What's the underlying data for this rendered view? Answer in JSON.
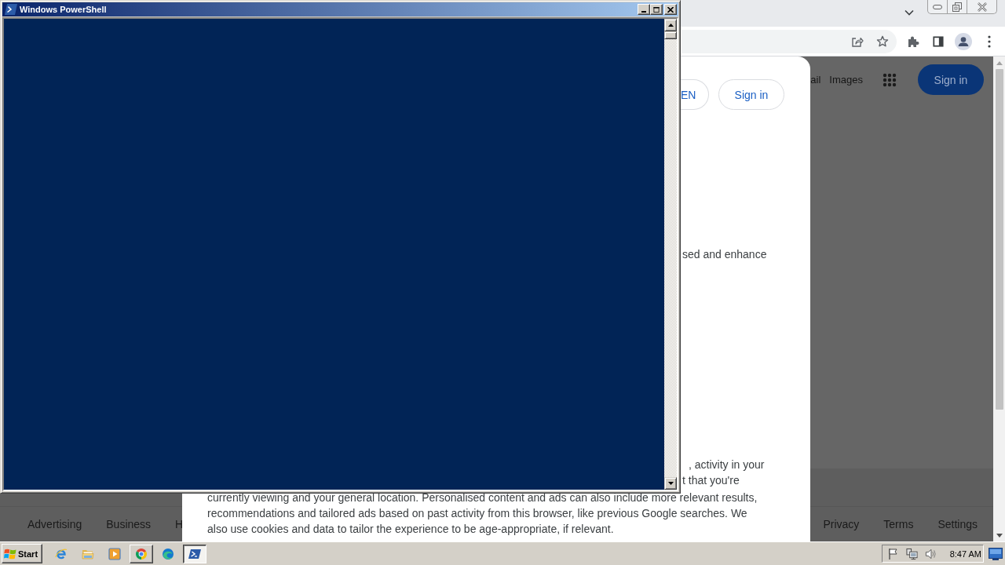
{
  "powershell_window": {
    "title": "Windows PowerShell"
  },
  "browser": {
    "page_header": {
      "links": [
        "ail",
        "Images"
      ],
      "sign_in_button": "Sign in"
    },
    "footer": {
      "left_links": [
        "Advertising",
        "Business",
        "H"
      ],
      "right_links": [
        "Privacy",
        "Terms",
        "Settings"
      ]
    },
    "consent_dialog": {
      "buttons": [
        "EN",
        "Sign in"
      ],
      "upper_fragment": "sed and enhance",
      "lower_fragments": [
        ", activity in your",
        "t that you're"
      ],
      "text_lines": [
        "currently viewing and your general location. Personalised content and ads can also include more relevant results,",
        "recommendations and tailored ads based on past activity from this browser, like previous Google searches. We",
        "also use cookies and data to tailor the experience to be age-appropriate, if relevant."
      ]
    }
  },
  "taskbar": {
    "start_button": "Start",
    "items": [
      {
        "running": false,
        "selected": false
      },
      {
        "running": false,
        "selected": false
      },
      {
        "running": false,
        "selected": false
      },
      {
        "running": true,
        "selected": false
      },
      {
        "running": false,
        "selected": false
      },
      {
        "running": true,
        "selected": true
      }
    ],
    "clock": "8:47 AM"
  }
}
